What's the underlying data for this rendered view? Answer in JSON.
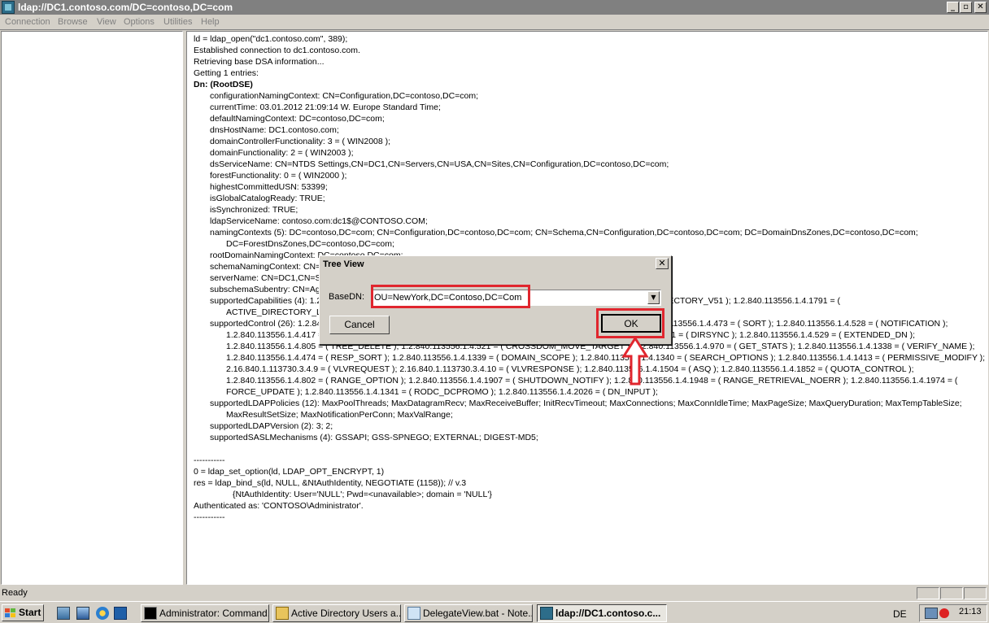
{
  "window": {
    "title": "ldap://DC1.contoso.com/DC=contoso,DC=com",
    "min": "_",
    "max": "▫",
    "close": "✕"
  },
  "menu": [
    "Connection",
    "Browse",
    "View",
    "Options",
    "Utilities",
    "Help"
  ],
  "output": [
    "ld = ldap_open(\"dc1.contoso.com\", 389);",
    "Established connection to dc1.contoso.com.",
    "Retrieving base DSA information...",
    "Getting 1 entries:",
    "Dn: (RootDSE)",
    "configurationNamingContext: CN=Configuration,DC=contoso,DC=com;",
    "currentTime: 03.01.2012 21:09:14 W. Europe Standard Time;",
    "defaultNamingContext: DC=contoso,DC=com;",
    "dnsHostName: DC1.contoso.com;",
    "domainControllerFunctionality: 3 = ( WIN2008 );",
    "domainFunctionality: 2 = ( WIN2003 );",
    "dsServiceName: CN=NTDS Settings,CN=DC1,CN=Servers,CN=USA,CN=Sites,CN=Configuration,DC=contoso,DC=com;",
    "forestFunctionality: 0 = ( WIN2000 );",
    "highestCommittedUSN: 53399;",
    "isGlobalCatalogReady: TRUE;",
    "isSynchronized: TRUE;",
    "ldapServiceName: contoso.com:dc1$@CONTOSO.COM;",
    "namingContexts (5): DC=contoso,DC=com; CN=Configuration,DC=contoso,DC=com; CN=Schema,CN=Configuration,DC=contoso,DC=com; DC=DomainDnsZones,DC=contoso,DC=com;",
    "DC=ForestDnsZones,DC=contoso,DC=com;",
    "rootDomainNamingContext: DC=contoso,DC=com;",
    "schemaNamingContext: CN=Schema,CN=Configuration,DC=contoso,DC=com;",
    "serverName: CN=DC1,CN=Servers,CN=USA,CN=Sites,CN=Configuration,DC=contoso,DC=com;",
    "subschemaSubentry: CN=Aggregate,CN=Schema,CN=Configuration,DC=contoso,DC=com;",
    "supportedCapabilities (4): 1.2.840.113556.1.4.800 = ( ACTIVE_DIRECTORY ); 1.2.840.113556.1.4.1670 = ( ACTIVE_DIRECTORY_V51 ); 1.2.840.113556.1.4.1791 = (",
    "ACTIVE_DIRECTORY_LDAP_INTEG ); 1.2.840.113556.1.4.1935 = ( ACTIVE_DIRECTORY_V60 );",
    "supportedControl (26): 1.2.840.113556.1.4.319 = ( PAGED_RESULT ); 1.2.840.113556.1.4.801 = ( SD_FLAGS ); 1.2.840.113556.1.4.473 = ( SORT ); 1.2.840.113556.1.4.528 = ( NOTIFICATION );",
    "1.2.840.113556.1.4.417 = ( SHOW_DELETED ); 1.2.840.113556.1.4.619 = ( LAZY_COMMIT ); 1.2.840.113556.1.4.841 = ( DIRSYNC ); 1.2.840.113556.1.4.529 = ( EXTENDED_DN );",
    "1.2.840.113556.1.4.805 = ( TREE_DELETE ); 1.2.840.113556.1.4.521 = ( CROSSDOM_MOVE_TARGET ); 1.2.840.113556.1.4.970 = ( GET_STATS ); 1.2.840.113556.1.4.1338 = ( VERIFY_NAME );",
    "1.2.840.113556.1.4.474 = ( RESP_SORT ); 1.2.840.113556.1.4.1339 = ( DOMAIN_SCOPE ); 1.2.840.113556.1.4.1340 = ( SEARCH_OPTIONS ); 1.2.840.113556.1.4.1413 = ( PERMISSIVE_MODIFY );",
    "2.16.840.1.113730.3.4.9 = ( VLVREQUEST ); 2.16.840.1.113730.3.4.10 = ( VLVRESPONSE ); 1.2.840.113556.1.4.1504 = ( ASQ ); 1.2.840.113556.1.4.1852 = ( QUOTA_CONTROL );",
    "1.2.840.113556.1.4.802 = ( RANGE_OPTION ); 1.2.840.113556.1.4.1907 = ( SHUTDOWN_NOTIFY ); 1.2.840.113556.1.4.1948 = ( RANGE_RETRIEVAL_NOERR ); 1.2.840.113556.1.4.1974 = (",
    "FORCE_UPDATE ); 1.2.840.113556.1.4.1341 = ( RODC_DCPROMO ); 1.2.840.113556.1.4.2026 = ( DN_INPUT );",
    "supportedLDAPPolicies (12): MaxPoolThreads; MaxDatagramRecv; MaxReceiveBuffer; InitRecvTimeout; MaxConnections; MaxConnIdleTime; MaxPageSize; MaxQueryDuration; MaxTempTableSize;",
    "MaxResultSetSize; MaxNotificationPerConn; MaxValRange;",
    "supportedLDAPVersion (2): 3; 2;",
    "supportedSASLMechanisms (4): GSSAPI; GSS-SPNEGO; EXTERNAL; DIGEST-MD5;",
    "",
    "-----------",
    "0 = ldap_set_option(ld, LDAP_OPT_ENCRYPT, 1)",
    "res = ldap_bind_s(ld, NULL, &NtAuthIdentity, NEGOTIATE (1158)); // v.3",
    "{NtAuthIdentity: User='NULL'; Pwd=<unavailable>; domain = 'NULL'}",
    "Authenticated as: 'CONTOSO\\Administrator'.",
    "-----------"
  ],
  "status": {
    "text": "Ready"
  },
  "taskbar": {
    "start": "Start",
    "tasks": [
      "Administrator: Command...",
      "Active Directory Users a...",
      "DelegateView.bat - Note...",
      "ldap://DC1.contoso.c..."
    ],
    "lang": "DE",
    "clock": "21:13"
  },
  "dialog": {
    "title": "Tree View",
    "close": "✕",
    "basedn_label": "BaseDN:",
    "basedn_value": "OU=NewYork,DC=Contoso,DC=Com",
    "dropdown": "▼",
    "cancel": "Cancel",
    "ok": "OK"
  },
  "colors": {
    "highlight": "#e0262e",
    "titlebar_inactive": "#808080"
  }
}
